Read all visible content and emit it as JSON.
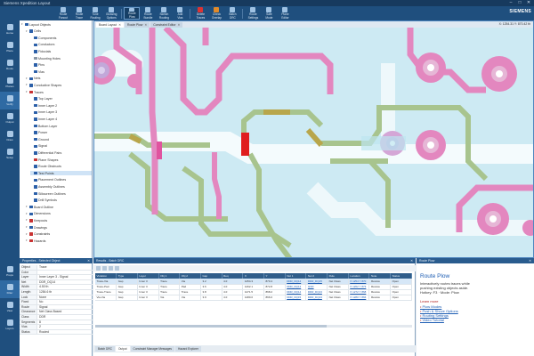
{
  "window": {
    "title": "Siemens Xpedition Layout",
    "brand": "SIEMENS",
    "controls": [
      "–",
      "□",
      "✕"
    ]
  },
  "ribbon": {
    "buttons": [
      {
        "label": "Route\nFanout",
        "icon": "route-fanout-icon"
      },
      {
        "label": "Route\nTrace",
        "icon": "route-trace-icon"
      },
      {
        "label": "Tune\nRouting",
        "icon": "tune-routing-icon"
      },
      {
        "label": "Glossing\nOptions",
        "icon": "glossing-icon"
      },
      {
        "label": "Route\nPlow",
        "icon": "plow-icon",
        "active": true
      },
      {
        "label": "Route\nBundle",
        "icon": "bundle-icon"
      },
      {
        "label": "Sketch\nRouting",
        "icon": "sketch-icon"
      },
      {
        "label": "Add\nVias",
        "icon": "add-vias-icon"
      },
      {
        "label": "Delete\nTraces",
        "icon": "delete-traces-icon",
        "color": "red"
      },
      {
        "label": "Check\nOverlap",
        "icon": "check-icon",
        "color": "orange"
      },
      {
        "label": "Batch\nDRC",
        "icon": "drc-icon"
      },
      {
        "label": "Route\nSettings",
        "icon": "settings-icon"
      },
      {
        "label": "Safe\nMode",
        "icon": "safe-mode-icon"
      },
      {
        "label": "Plane\nEditor",
        "icon": "plane-editor-icon"
      }
    ]
  },
  "activity": {
    "items": [
      {
        "label": "Home",
        "icon": "home-icon"
      },
      {
        "label": "Place",
        "icon": "place-icon"
      },
      {
        "label": "Route",
        "icon": "route-icon"
      },
      {
        "label": "Planes",
        "icon": "planes-icon"
      },
      {
        "label": "Verify",
        "icon": "verify-icon",
        "active": true
      },
      {
        "label": "Output",
        "icon": "output-icon"
      },
      {
        "label": "Draw",
        "icon": "draw-icon"
      },
      {
        "label": "Setup",
        "icon": "setup-icon"
      }
    ],
    "lower_items": [
      {
        "label": "Props",
        "icon": "properties-icon"
      },
      {
        "label": "Filter",
        "icon": "filter-icon",
        "active": true
      },
      {
        "label": "View",
        "icon": "view-icon"
      },
      {
        "label": "Layers",
        "icon": "layers-icon"
      }
    ]
  },
  "tree": {
    "nodes": [
      {
        "label": "Layout Objects",
        "depth": 0,
        "icon": "blue"
      },
      {
        "label": "Cells",
        "depth": 1,
        "icon": "blue"
      },
      {
        "label": "Components",
        "depth": 2,
        "icon": "blue"
      },
      {
        "label": "Conductors",
        "depth": 2,
        "icon": "blue"
      },
      {
        "label": "Fiducials",
        "depth": 2,
        "icon": "blue"
      },
      {
        "label": "Mounting Holes",
        "depth": 2,
        "icon": "gray"
      },
      {
        "label": "Pins",
        "depth": 2,
        "icon": "blue"
      },
      {
        "label": "Vias",
        "depth": 2,
        "icon": "blue"
      },
      {
        "label": "Nets",
        "depth": 1,
        "icon": "blue"
      },
      {
        "label": "Conductive Shapes",
        "depth": 1,
        "icon": "blue"
      },
      {
        "label": "Traces",
        "depth": 1,
        "icon": "red"
      },
      {
        "label": "Top Layer",
        "depth": 2,
        "icon": "blue"
      },
      {
        "label": "Inner Layer 2",
        "depth": 2,
        "icon": "blue"
      },
      {
        "label": "Inner Layer 3",
        "depth": 2,
        "icon": "blue"
      },
      {
        "label": "Inner Layer 4",
        "depth": 2,
        "icon": "blue"
      },
      {
        "label": "Bottom Layer",
        "depth": 2,
        "icon": "blue"
      },
      {
        "label": "Power",
        "depth": 2,
        "icon": "blue"
      },
      {
        "label": "Ground",
        "depth": 2,
        "icon": "blue"
      },
      {
        "label": "Signal",
        "depth": 2,
        "icon": "blue"
      },
      {
        "label": "Differential Pairs",
        "depth": 2,
        "icon": "blue"
      },
      {
        "label": "Plane Shapes",
        "depth": 2,
        "icon": "red"
      },
      {
        "label": "Route Obstructs",
        "depth": 2,
        "icon": "blue"
      },
      {
        "label": "Test Points",
        "depth": 2,
        "icon": "blue",
        "selected": true
      },
      {
        "label": "Placement Outlines",
        "depth": 2,
        "icon": "blue"
      },
      {
        "label": "Assembly Outlines",
        "depth": 2,
        "icon": "blue"
      },
      {
        "label": "Silkscreen Outlines",
        "depth": 2,
        "icon": "blue"
      },
      {
        "label": "Drill Symbols",
        "depth": 2,
        "icon": "blue"
      },
      {
        "label": "Board Outline",
        "depth": 1,
        "icon": "blue"
      },
      {
        "label": "Dimensions",
        "depth": 1,
        "icon": "blue"
      },
      {
        "label": "Keepouts",
        "depth": 1,
        "icon": "red"
      },
      {
        "label": "Drawings",
        "depth": 1,
        "icon": "blue"
      },
      {
        "label": "Constraints",
        "depth": 1,
        "icon": "red"
      },
      {
        "label": "Hazards",
        "depth": 1,
        "icon": "red"
      }
    ]
  },
  "canvas": {
    "tabs": [
      {
        "label": "Board Layout",
        "active": true
      },
      {
        "label": "Route Plow",
        "active": false
      },
      {
        "label": "Constraint Editor",
        "active": false
      }
    ],
    "coordinate_readout": "X: 1254.31  Y: 870.42 th"
  },
  "properties": {
    "header": "Properties - Selected Object",
    "rows": [
      {
        "k": "Object",
        "v": "Trace"
      },
      {
        "k": "Color",
        "v": ""
      },
      {
        "k": "Layer",
        "v": "Inner Layer 3 - Signal"
      },
      {
        "k": "Net",
        "v": "DDR_DQ14"
      },
      {
        "k": "Width",
        "v": "4.50 th"
      },
      {
        "k": "Length",
        "v": "1284.6 th"
      },
      {
        "k": "Lock",
        "v": "None"
      },
      {
        "k": "Fixed",
        "v": "No"
      },
      {
        "k": "Route",
        "v": "Signal"
      },
      {
        "k": "Clearance",
        "v": "Net Class Based"
      },
      {
        "k": "Class",
        "v": "DDR"
      },
      {
        "k": "Segments",
        "v": "8"
      },
      {
        "k": "Vias",
        "v": "2"
      },
      {
        "k": "Status",
        "v": "Routed"
      }
    ]
  },
  "results": {
    "header": "Results - Batch DRC",
    "columns": [
      "Violation",
      "Type",
      "Layer",
      "Obj 1",
      "Obj 2",
      "Gap",
      "Req",
      "X",
      "Y",
      "Net 1",
      "Net 2",
      "Rule",
      "Location",
      "Note",
      "Status"
    ],
    "rows": [
      [
        "Trace-Via",
        "Gap",
        "Inner 3",
        "Trace",
        "Via",
        "3.2",
        "4.0",
        "1254.3",
        "870.4",
        "DDR_DQ14",
        "DDR_DQ15",
        "Net Class",
        "X 1254 Y 870",
        "Review",
        "Open"
      ],
      [
        "Trace-Pad",
        "Gap",
        "Inner 3",
        "Trace",
        "Pad",
        "3.6",
        "4.0",
        "1262.1",
        "872.8",
        "DDR_DQ14",
        "GND",
        "Net Class",
        "X 1262 Y 873",
        "Review",
        "Open"
      ],
      [
        "Trace-Trace",
        "Gap",
        "Inner 3",
        "Trace",
        "Trace",
        "3.8",
        "4.0",
        "1271.5",
        "868.2",
        "DDR_DQ14",
        "DDR_DQ13",
        "Net Class",
        "X 1272 Y 868",
        "Review",
        "Open"
      ],
      [
        "Via-Via",
        "Gap",
        "Inner 3",
        "Via",
        "Via",
        "3.9",
        "4.0",
        "1280.0",
        "866.0",
        "DDR_DQ15",
        "DDR_DQ13",
        "Net Class",
        "X 1280 Y 866",
        "Review",
        "Open"
      ]
    ],
    "bottom_tabs": [
      {
        "label": "Batch DRC",
        "active": false
      },
      {
        "label": "Output",
        "active": true
      },
      {
        "label": "Constraint Manager Messages",
        "active": false
      },
      {
        "label": "Hazard Explorer",
        "active": false
      }
    ]
  },
  "info": {
    "header": "Route Plow",
    "title": "Route Plow",
    "lines": [
      "Interactively routes traces while",
      "pushing existing objects aside.",
      "Hotkey: F3  ·  Mode: Plow"
    ],
    "links_title": "Learn more",
    "links": [
      "Plow Modes",
      "Push & Shove Options",
      "Routing Settings",
      "Video Tutorial"
    ]
  }
}
